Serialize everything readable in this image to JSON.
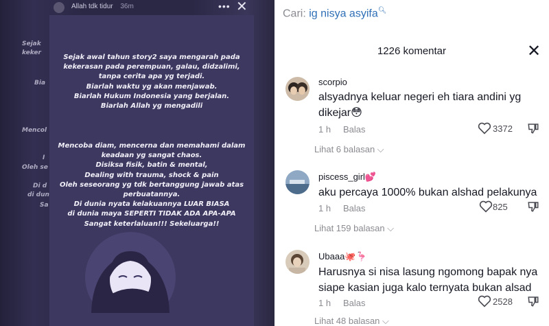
{
  "story": {
    "username": "Allah tdk tidur",
    "time": "36m",
    "more_glyph": "•••",
    "close_glyph": "✕",
    "edge_fragments": [
      "Sejak",
      "keker",
      "Bia",
      "Mencol",
      "I",
      "Oleh se",
      "Di d",
      "di dun",
      "Sa"
    ],
    "paragraph1": [
      "Sejak awal tahun story2 saya mengarah pada",
      "kekerasan pada perempuan, galau, didzalimi,",
      "tanpa cerita apa yg terjadi.",
      "Biarlah waktu yg akan menjawab.",
      "Biarlah Hukum Indonesia yang berjalan.",
      "Biarlah Allah yg mengadili"
    ],
    "paragraph2": [
      "Mencoba diam, mencerna dan memahami dalam",
      "keadaan yg sangat chaos.",
      "Disiksa fisik, batin & mental,",
      "Dealing with trauma, shock & pain",
      "Oleh seseorang yg tdk bertanggung jawab atas",
      "perbuatannya.",
      "Di dunia nyata kelakuannya LUAR BIASA",
      "di dunia maya SEPERTI TIDAK ADA APA-APA",
      "Sangat keterlaluan!!! Sekeluarga!!"
    ]
  },
  "comments_panel": {
    "search_label": "Cari:",
    "search_query": "ig nisya asyifa",
    "search_icon": "search-icon",
    "count_label": "1226 komentar",
    "close_glyph": "✕",
    "comments": [
      {
        "username": "scorpio",
        "text": "alsyadnya keluar negeri eh tiara andini yg dikejar😳",
        "time": "1 h",
        "reply": "Balas",
        "likes": "3372",
        "view_replies": "Lihat 6 balasan ⌵"
      },
      {
        "username": "piscess_girl💕",
        "text": "aku percaya 1000% bukan alshad pelakunya",
        "time": "1 h",
        "reply": "Balas",
        "likes": "825",
        "view_replies": "Lihat 159 balasan ⌵"
      },
      {
        "username": "Ubaaa🐙🦩",
        "text": "Harusnya si nisa lasung ngomong bapak nya siape kasian juga kalo ternyata bukan alsad",
        "time": "1 h",
        "reply": "Balas",
        "likes": "2528",
        "view_replies": "Lihat 48 balasan ⌵"
      }
    ]
  },
  "colors": {
    "story_bg": "#3d3860",
    "link_blue": "#2e6fb6",
    "muted_grey": "#8a8b91",
    "text_dark": "#161823"
  }
}
